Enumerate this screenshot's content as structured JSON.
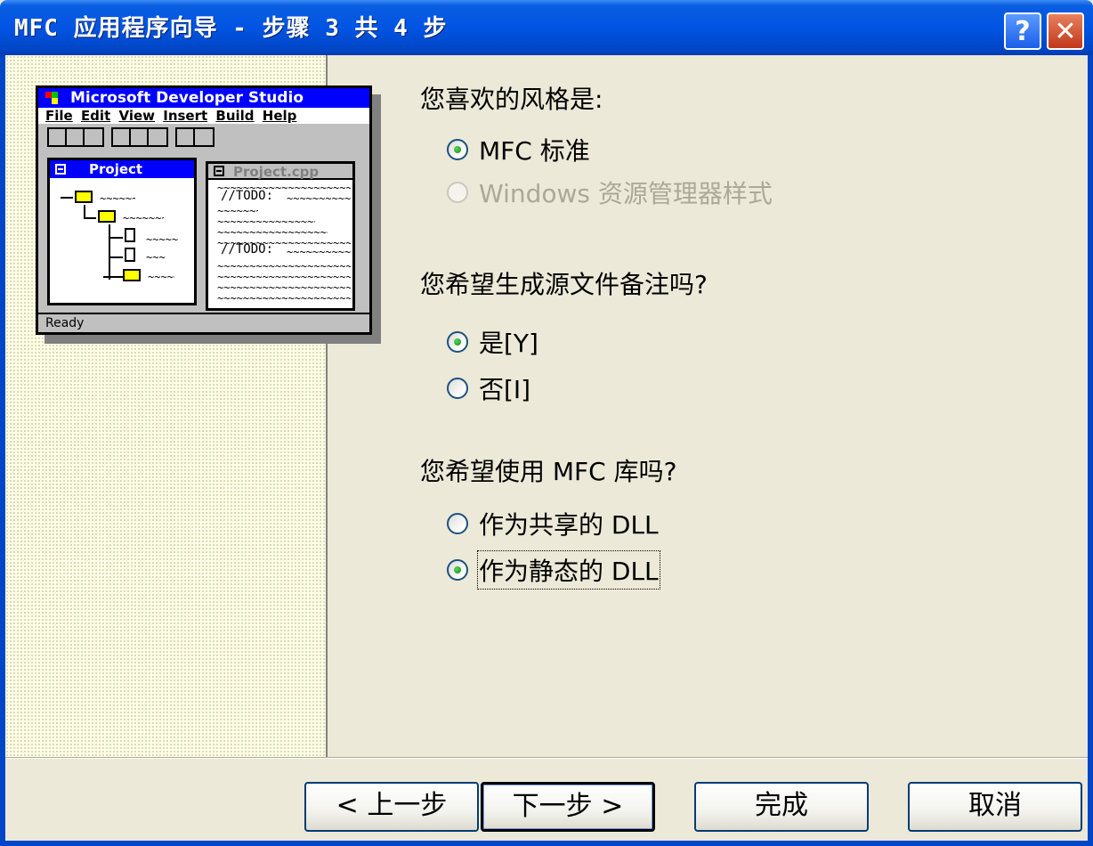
{
  "window": {
    "title": "MFC 应用程序向导 - 步骤 3 共 4 步",
    "help_label": "?",
    "close_label": "✕"
  },
  "illustration": {
    "app_title": "Microsoft Developer Studio",
    "menu": [
      "File",
      "Edit",
      "View",
      "Insert",
      "Build",
      "Help"
    ],
    "project_pane_title": "Project",
    "code_pane_title": "Project.cpp",
    "code_todo_1": "//TODO:",
    "code_todo_2": "//TODO:",
    "status": "Ready"
  },
  "questions": {
    "style": {
      "label": "您喜欢的风格是:",
      "options": [
        {
          "label": "MFC 标准",
          "checked": true,
          "enabled": true
        },
        {
          "label": "Windows 资源管理器样式",
          "checked": false,
          "enabled": false
        }
      ]
    },
    "comments": {
      "label": "您希望生成源文件备注吗?",
      "options": [
        {
          "label": "是[Y]",
          "checked": true,
          "enabled": true
        },
        {
          "label": "否[I]",
          "checked": false,
          "enabled": true
        }
      ]
    },
    "mfc_library": {
      "label": "您希望使用 MFC 库吗?",
      "options": [
        {
          "label": "作为共享的 DLL",
          "checked": false,
          "enabled": true
        },
        {
          "label": "作为静态的 DLL",
          "checked": true,
          "enabled": true
        }
      ]
    }
  },
  "buttons": {
    "back": "< 上一步",
    "next": "下一步 >",
    "finish": "完成",
    "cancel": "取消"
  }
}
